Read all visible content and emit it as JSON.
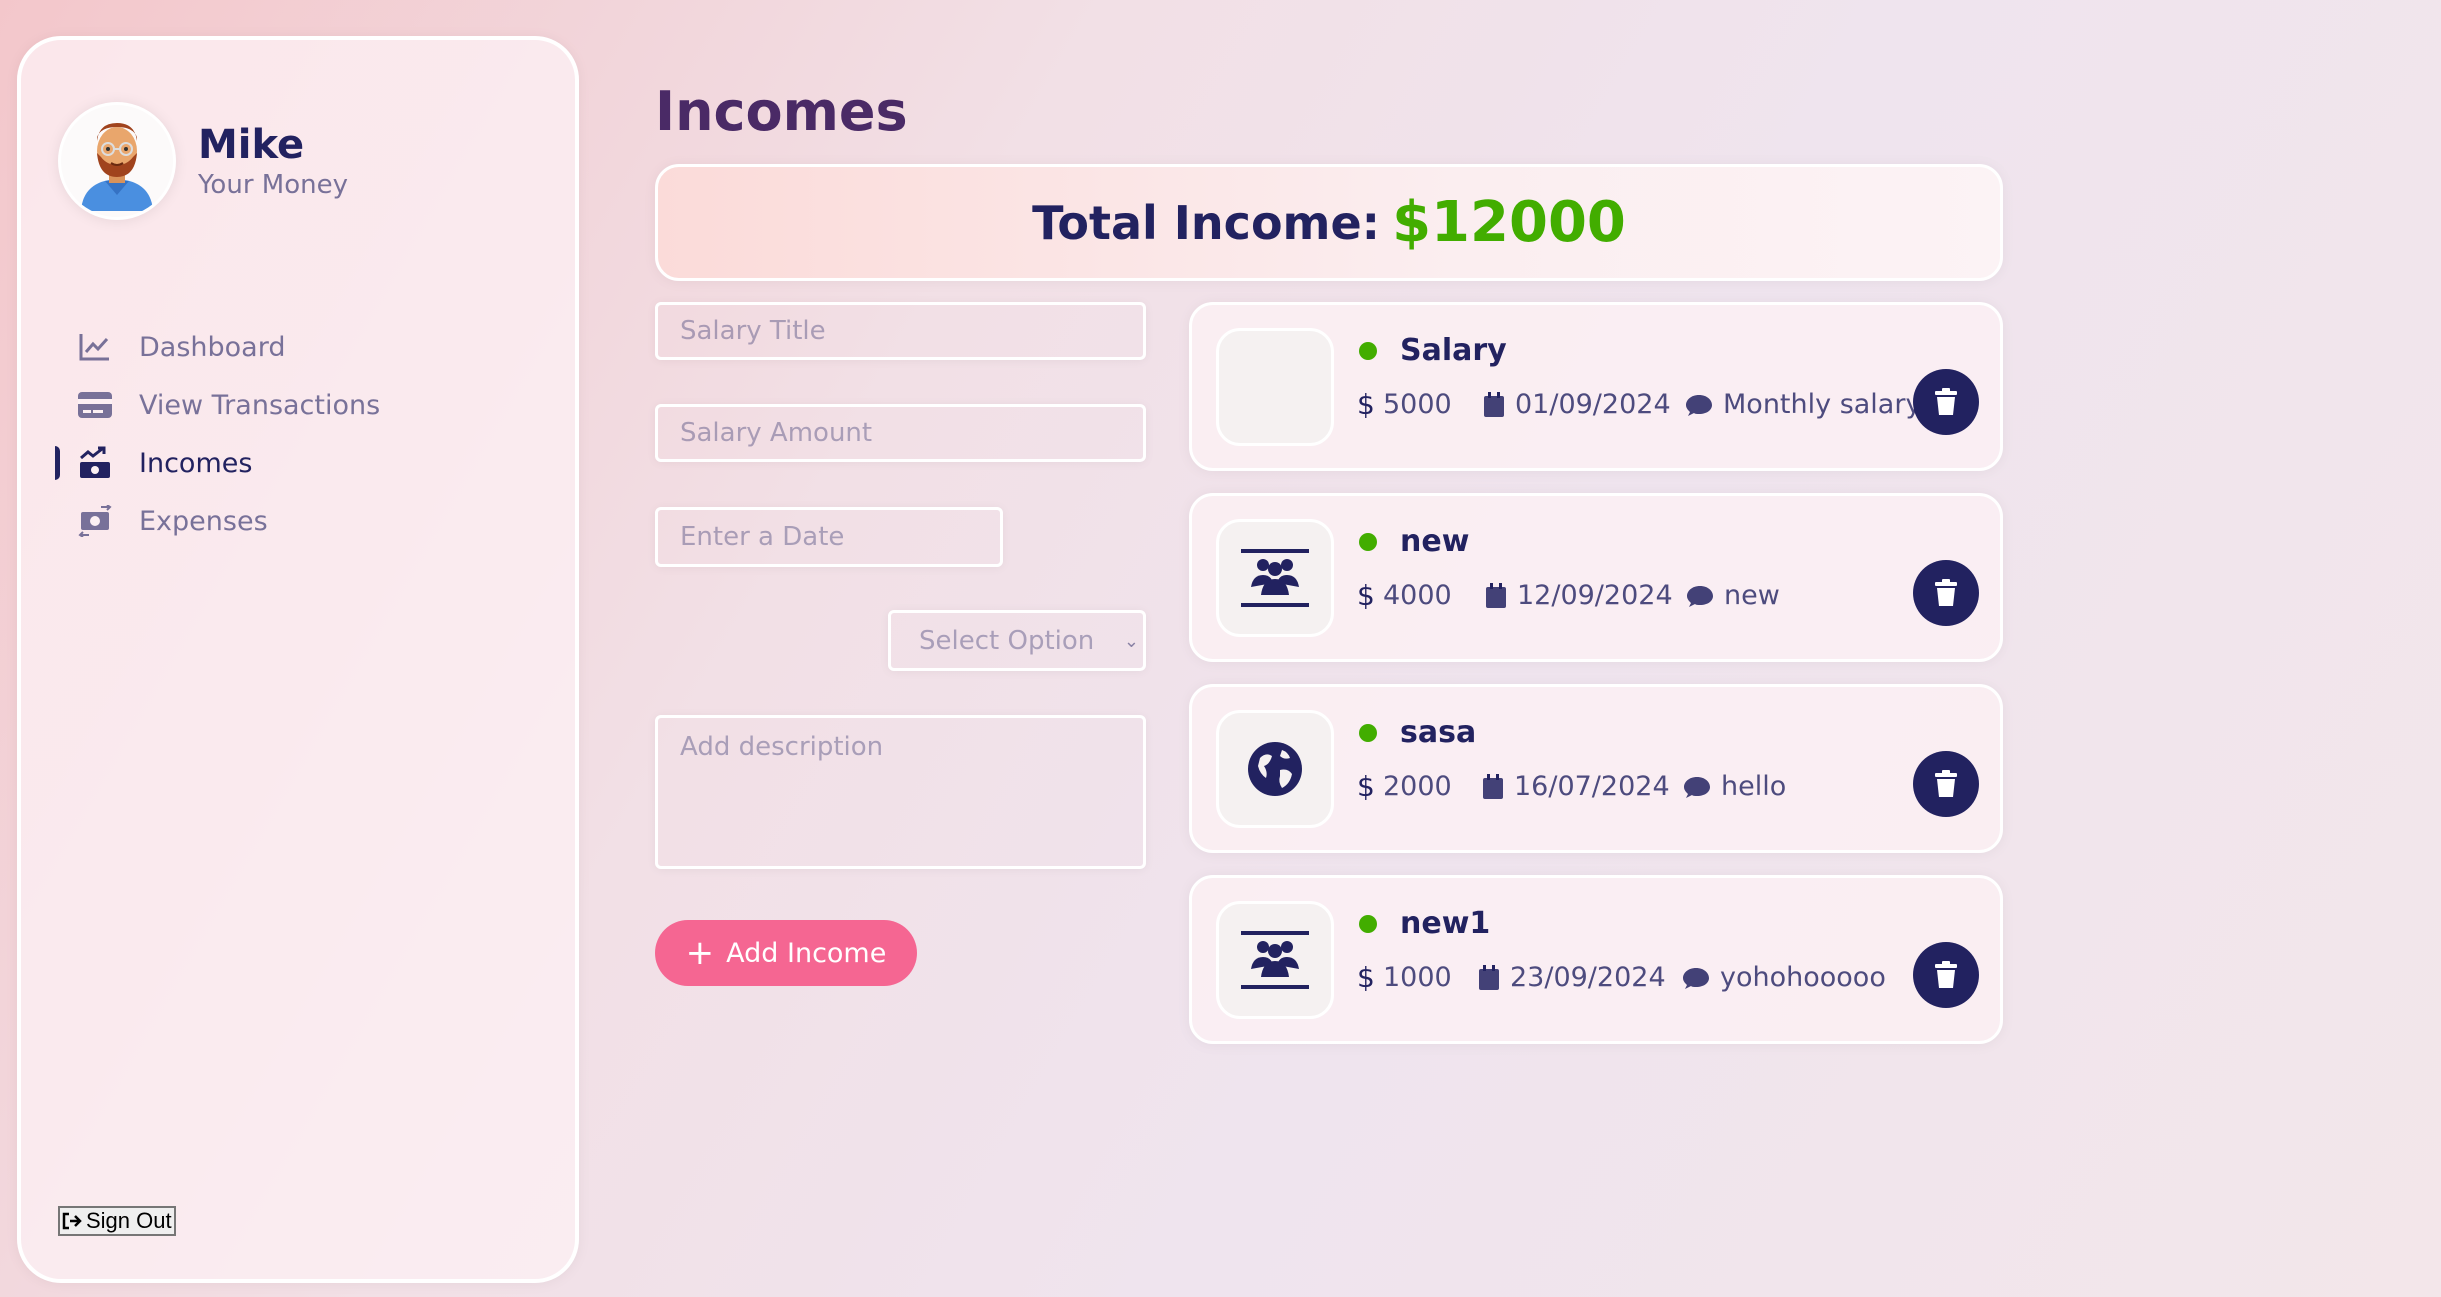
{
  "profile": {
    "name": "Mike",
    "subtitle": "Your Money"
  },
  "nav": {
    "items": [
      {
        "label": "Dashboard",
        "icon": "chart-line-icon",
        "active": false
      },
      {
        "label": "View Transactions",
        "icon": "credit-card-icon",
        "active": false
      },
      {
        "label": "Incomes",
        "icon": "money-bill-trend-up-icon",
        "active": true
      },
      {
        "label": "Expenses",
        "icon": "money-bill-transfer-icon",
        "active": false
      }
    ],
    "signout_label": "Sign Out"
  },
  "page": {
    "title": "Incomes"
  },
  "total": {
    "label": "Total Income:",
    "value": "$12000"
  },
  "form": {
    "title_placeholder": "Salary Title",
    "amount_placeholder": "Salary Amount",
    "date_placeholder": "Enter a Date",
    "select_placeholder": "Select Option",
    "description_placeholder": "Add description",
    "submit_label": "Add Income",
    "submit_icon": "plus-icon"
  },
  "incomes": [
    {
      "title": "Salary",
      "amount": "5000",
      "date": "01/09/2024",
      "description": "Monthly salary",
      "icon": "blank-icon"
    },
    {
      "title": "new",
      "amount": "4000",
      "date": "12/09/2024",
      "description": "new",
      "icon": "users-icon"
    },
    {
      "title": "sasa",
      "amount": "2000",
      "date": "16/07/2024",
      "description": "hello",
      "icon": "globe-icon"
    },
    {
      "title": "new1",
      "amount": "1000",
      "date": "23/09/2024",
      "description": "yohohooooo",
      "icon": "users-icon"
    }
  ],
  "colors": {
    "primary": "#222260",
    "accent": "#f56692",
    "income_green": "#42ad00"
  }
}
